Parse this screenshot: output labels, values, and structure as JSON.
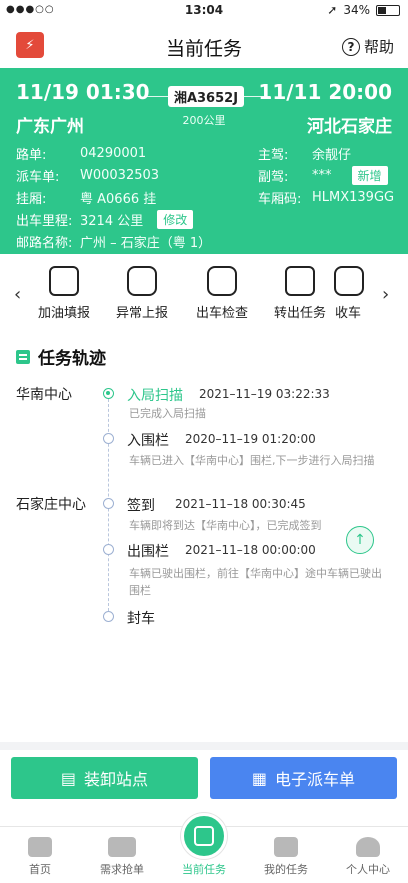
{
  "status": {
    "carrier": "●●●○○",
    "time": "13:04",
    "battery": "34%"
  },
  "nav": {
    "title": "当前任务",
    "help": "帮助"
  },
  "route": {
    "depart_time": "11/19 01:30",
    "arrive_time": "11/11 20:00",
    "plate": "湘A3652J",
    "distance": "200公里",
    "from_city": "广东广州",
    "to_city": "河北石家庄",
    "fields": {
      "route_no_label": "路单:",
      "route_no": "04290001",
      "dispatch_label": "派车单:",
      "dispatch_no": "W00032503",
      "trailer_label": "挂厢:",
      "trailer": "粤 A0666 挂",
      "mileage_label": "出车里程:",
      "mileage": "3214 公里",
      "edit_label": "修改",
      "mail_route_label": "邮路名称:",
      "mail_route": "广州 – 石家庄（粤 1）",
      "driver_label": "主驾:",
      "driver": "余靓仔",
      "codriver_label": "副驾:",
      "codriver": "***",
      "add_label": "新增",
      "carriage_label": "车厢码:",
      "carriage": "HLMX139GG"
    }
  },
  "actions": {
    "prev_arrow": "‹",
    "next_arrow": "›",
    "items": [
      {
        "label": "加油填报",
        "icon": "fuel-icon"
      },
      {
        "label": "异常上报",
        "icon": "truck-alert-icon"
      },
      {
        "label": "出车检查",
        "icon": "truck-check-icon"
      },
      {
        "label": "转出任务",
        "icon": "transfer-icon"
      },
      {
        "label": "收车",
        "icon": "truck-icon"
      }
    ]
  },
  "track": {
    "title": "任务轨迹",
    "hubs": [
      "华南中心",
      "石家庄中心"
    ],
    "events": [
      {
        "title": "入局扫描",
        "time": "2021–11–19 03:22:33",
        "desc": "已完成入局扫描"
      },
      {
        "title": "入围栏",
        "time": "2020–11–19 01:20:00",
        "desc": "车辆已进入【华南中心】围栏,下一步进行入局扫描"
      },
      {
        "title": "签到",
        "time": "2021–11–18 00:30:45",
        "desc": "车辆即将到达【华南中心】，已完成签到"
      },
      {
        "title": "出围栏",
        "time": "2021–11–18 00:00:00",
        "desc": "车辆已驶出围栏，前往【华南中心】途中车辆已驶出围栏"
      },
      {
        "title": "封车",
        "time": "",
        "desc": ""
      }
    ]
  },
  "buttons": {
    "loading_sites": "装卸站点",
    "e_dispatch": "电子派车单"
  },
  "tabs": [
    {
      "label": "首页"
    },
    {
      "label": "需求抢单"
    },
    {
      "label": "当前任务"
    },
    {
      "label": "我的任务"
    },
    {
      "label": "个人中心"
    }
  ],
  "colors": {
    "accent": "#2dc68b",
    "blue": "#4a85f0"
  }
}
